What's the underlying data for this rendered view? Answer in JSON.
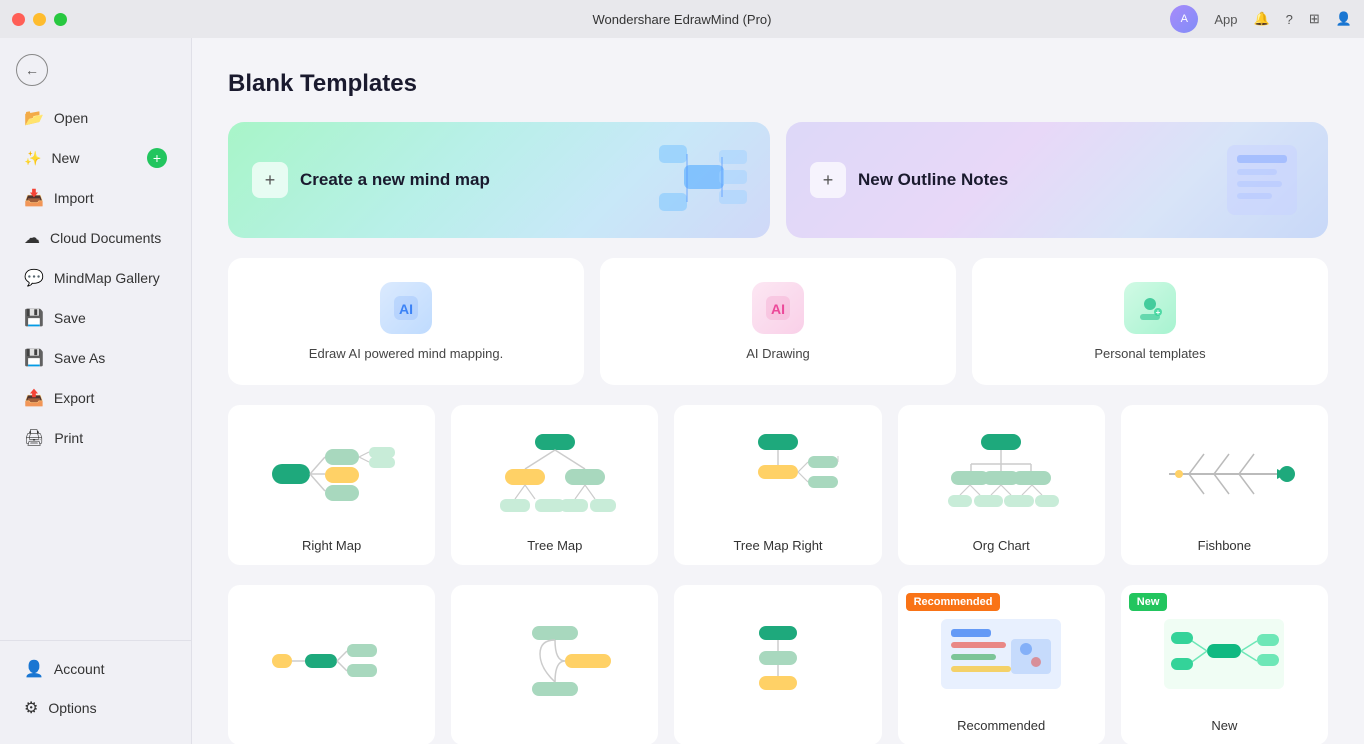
{
  "titlebar": {
    "title": "Wondershare EdrawMind (Pro)",
    "app_button": "App"
  },
  "sidebar": {
    "back_label": "←",
    "items": [
      {
        "id": "open",
        "label": "Open",
        "icon": "📂"
      },
      {
        "id": "new",
        "label": "New",
        "icon": "➕",
        "has_plus": true
      },
      {
        "id": "import",
        "label": "Import",
        "icon": "📥"
      },
      {
        "id": "cloud",
        "label": "Cloud Documents",
        "icon": "☁"
      },
      {
        "id": "gallery",
        "label": "MindMap Gallery",
        "icon": "💬"
      },
      {
        "id": "save",
        "label": "Save",
        "icon": "💾"
      },
      {
        "id": "saveas",
        "label": "Save As",
        "icon": "💾"
      },
      {
        "id": "export",
        "label": "Export",
        "icon": "📤"
      },
      {
        "id": "print",
        "label": "Print",
        "icon": "🖨"
      }
    ],
    "bottom_items": [
      {
        "id": "account",
        "label": "Account",
        "icon": "👤"
      },
      {
        "id": "options",
        "label": "Options",
        "icon": "⚙"
      }
    ]
  },
  "main": {
    "page_title": "Blank Templates",
    "hero_cards": [
      {
        "id": "new-mind-map",
        "label": "Create a new mind map",
        "gradient": "left"
      },
      {
        "id": "new-outline",
        "label": "New Outline Notes",
        "gradient": "right"
      }
    ],
    "feature_cards": [
      {
        "id": "ai-mind-map",
        "label": "Edraw AI powered mind mapping.",
        "icon_type": "ai"
      },
      {
        "id": "ai-drawing",
        "label": "AI Drawing",
        "icon_type": "drawing"
      },
      {
        "id": "personal-templates",
        "label": "Personal templates",
        "icon_type": "personal"
      }
    ],
    "template_cards": [
      {
        "id": "right-map",
        "label": "Right Map",
        "badge": null
      },
      {
        "id": "tree-map",
        "label": "Tree Map",
        "badge": null
      },
      {
        "id": "tree-map-right",
        "label": "Tree Map Right",
        "badge": null
      },
      {
        "id": "org-chart",
        "label": "Org Chart",
        "badge": null
      },
      {
        "id": "fishbone",
        "label": "Fishbone",
        "badge": null
      }
    ],
    "bottom_cards": [
      {
        "id": "bottom-1",
        "label": "",
        "badge": null
      },
      {
        "id": "bottom-2",
        "label": "",
        "badge": null
      },
      {
        "id": "bottom-3",
        "label": "",
        "badge": null
      },
      {
        "id": "bottom-recommended",
        "label": "Recommended",
        "badge": "recommended"
      },
      {
        "id": "bottom-new",
        "label": "New",
        "badge": "new"
      }
    ]
  }
}
